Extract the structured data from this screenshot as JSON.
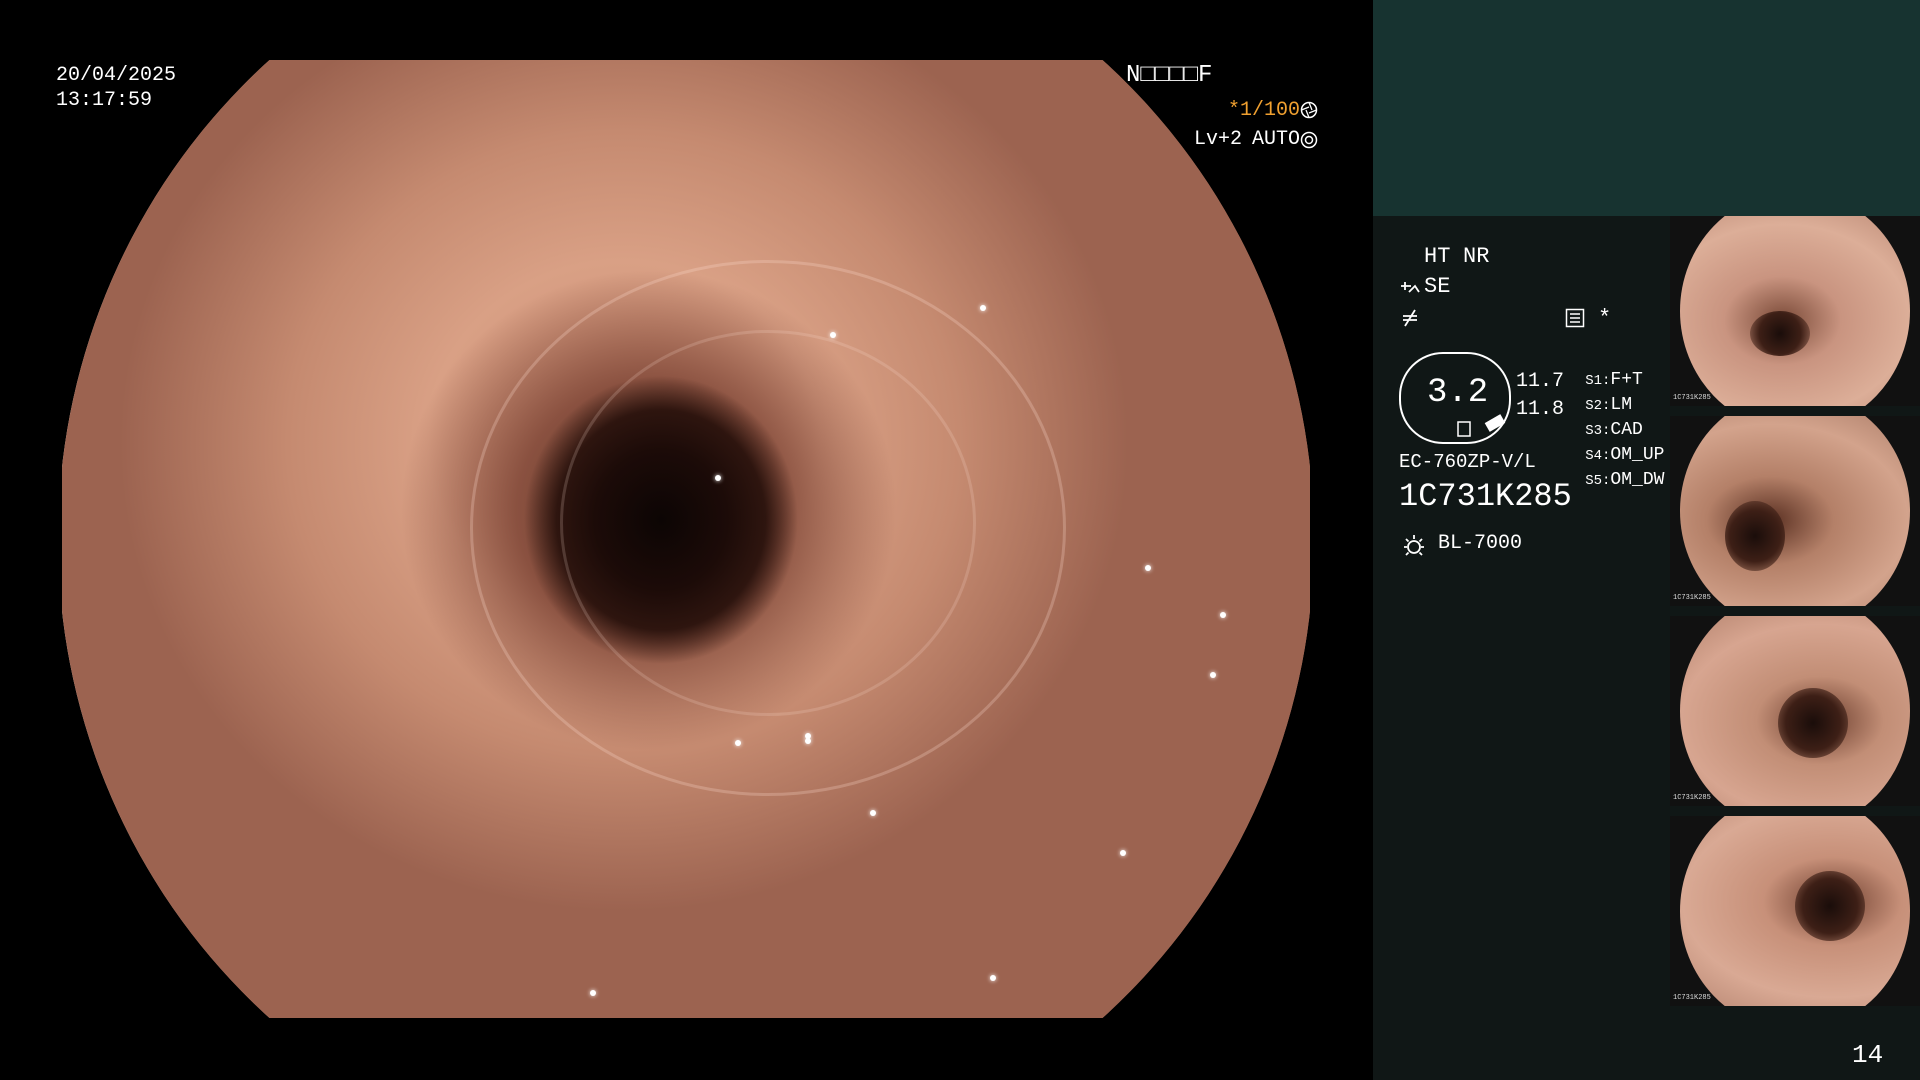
{
  "main_overlay": {
    "date": "20/04/2025",
    "time": "13:17:59",
    "mode_code": "N□□□□F",
    "shutter": "*1/100",
    "level": "Lv+2",
    "iris": "AUTO"
  },
  "panel": {
    "ht_label": "HT",
    "nr_label": "NR",
    "se_label": "SE",
    "asterisk": "*",
    "zoom_value": "3.2",
    "val_top": "11.7",
    "val_bottom": "11.8",
    "scope_model": "EC-760ZP-V/L",
    "serial": "1C731K285",
    "light_source": "BL-7000",
    "switches": [
      {
        "key": "S1:",
        "value": "F+T"
      },
      {
        "key": "S2:",
        "value": "LM"
      },
      {
        "key": "S3:",
        "value": "CAD"
      },
      {
        "key": "S4:",
        "value": "OM_UP"
      },
      {
        "key": "S5:",
        "value": "OM_DW"
      }
    ],
    "page_number": "14"
  },
  "thumbnails": [
    {
      "serial": "1C731K285"
    },
    {
      "serial": "1C731K285"
    },
    {
      "serial": "1C731K285"
    },
    {
      "serial": "1C731K285"
    }
  ],
  "colors": {
    "panel_bg": "#101716",
    "panel_top_bg": "#173330",
    "accent_orange": "#f0a030"
  },
  "icons": [
    "aperture-icon",
    "iris-icon",
    "scope-tip-icon",
    "no-freeze-icon",
    "capture-icon",
    "lamp-icon"
  ]
}
